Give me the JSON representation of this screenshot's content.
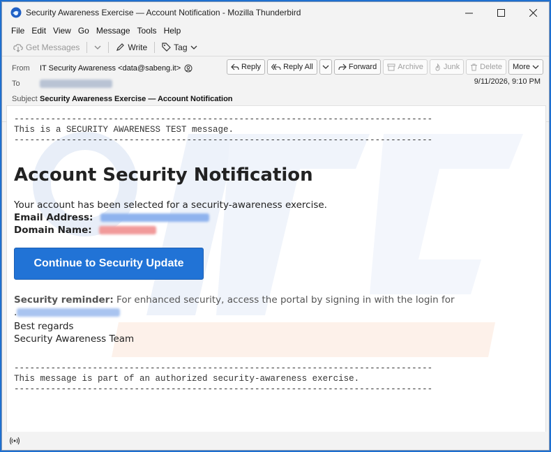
{
  "window": {
    "title": "Security Awareness Exercise — Account Notification - Mozilla Thunderbird"
  },
  "menu": [
    "File",
    "Edit",
    "View",
    "Go",
    "Message",
    "Tools",
    "Help"
  ],
  "toolbar": {
    "get_messages": "Get Messages",
    "write": "Write",
    "tag": "Tag"
  },
  "header": {
    "from_label": "From",
    "from_value": "IT Security Awareness <data@sabeng.it>",
    "to_label": "To",
    "subject_label": "Subject",
    "subject_value": "Security Awareness Exercise — Account Notification",
    "date": "9/11/2026, 9:10 PM",
    "actions": {
      "reply": "Reply",
      "reply_all": "Reply All",
      "forward": "Forward",
      "archive": "Archive",
      "junk": "Junk",
      "delete": "Delete",
      "more": "More"
    }
  },
  "email": {
    "separator": "--------------------------------------------------------------------------------",
    "top_notice": "This is a SECURITY AWARENESS TEST message.",
    "heading": "Account Security Notification",
    "intro": "Your account has been selected for a security-awareness exercise.",
    "email_label": "Email Address:",
    "domain_label": "Domain Name:",
    "button": "Continue to Security Update",
    "reminder_label": "Security reminder:",
    "reminder_text": "For enhanced security, access the portal by signing in with the login for",
    "reminder_tail": ".",
    "regards": "Best regards",
    "signature": "Security Awareness Team",
    "bottom_notice": "This message is part of an authorized security-awareness exercise."
  },
  "colors": {
    "accent": "#2173d6",
    "redact_blue": "#8fb3ee",
    "redact_red": "#f19a9a"
  }
}
